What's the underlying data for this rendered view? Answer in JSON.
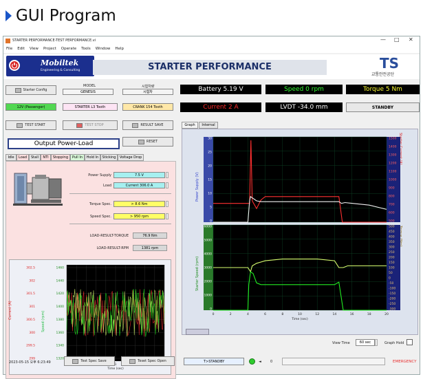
{
  "page_title": "GUI Program",
  "window": {
    "title": "STARTER PERFORMANCE-TEST PERFORMANCE.vi",
    "controls": [
      "—",
      "□",
      "✕"
    ],
    "menu": [
      "File",
      "Edit",
      "View",
      "Project",
      "Operate",
      "Tools",
      "Window",
      "Help"
    ]
  },
  "header": {
    "logo_name": "Mobiltek",
    "logo_sub": "Engineering & Consulting",
    "app_title": "STARTER PERFORMANCE",
    "ts_logo": "TS",
    "ts_sub": "교통안전공단"
  },
  "config": {
    "button": "Starter Config",
    "model_label": "MODEL",
    "model_value": "GENESIS",
    "sample_label": "시험차량",
    "sample_value": "시험차",
    "voltage_type": "12V (Passenger)",
    "starter_tooth": "STARTER L3 Tooth",
    "crank_tooth": "CRANK 154 Tooth"
  },
  "status": {
    "battery": "Battery 5.19 V",
    "speed": "Speed 0 rpm",
    "torque": "Torque 5 Nm",
    "current": "Current 2 A",
    "lvdt": "LVDT -34.0 mm",
    "state": "STANDBY"
  },
  "colors": {
    "battery": "#ffffff",
    "speed": "#33ff33",
    "torque": "#ffff33",
    "current": "#ff2a2a",
    "lvdt": "#ffffff"
  },
  "controls": {
    "test_start": "TEST START",
    "test_stop": "TEST STOP",
    "result_save": "RESULT SAVE",
    "reset": "RESET",
    "mode_display": "Output Power-Load"
  },
  "left_tabs": [
    "Idle",
    "Load",
    "Stall",
    "NTI",
    "Stopping",
    "Pull In",
    "Hold In",
    "Sticking",
    "Voltage Drop"
  ],
  "load": {
    "power_supply_label": "Power Supply",
    "power_supply_value": "7.5 V",
    "load_label": "Load",
    "load_value": "Current 306.0 A",
    "torque_spec_label": "Torque Spec.",
    "torque_spec_value": "> 8.6 Nm",
    "speed_spec_label": "Speed Spec.",
    "speed_spec_value": "> 950 rpm",
    "result_torque_label": "LOAD-RESULT-TORQUE",
    "result_torque_value": "76.9 Nm",
    "result_rpm_label": "LOAD-RESULT-RPM",
    "result_rpm_value": "1381 rpm"
  },
  "small_chart": {
    "left_axis_label": "Current (A)",
    "right_axis_label": "Speed (rpm)",
    "left_ticks": [
      "302.5",
      "302",
      "301.5",
      "301",
      "300.5",
      "300",
      "299.5",
      "299"
    ],
    "right_ticks": [
      "1460",
      "1440",
      "1420",
      "1400",
      "1380",
      "1360",
      "1340",
      "1320"
    ],
    "x_ticks": [
      "0",
      "0.2",
      "0.4",
      "0.6",
      "0.8",
      "1",
      "1.2",
      "1.4",
      "1.6",
      "1.8",
      "2"
    ],
    "xlabel": "Time (sec)"
  },
  "graph_tabs": [
    "Graph",
    "Internal"
  ],
  "chart_data": {
    "type": "line",
    "top": {
      "left_label": "Power Supply (V)",
      "right_label": "Starter Current (A)",
      "left_ticks": [
        "30",
        "25",
        "20",
        "15",
        "10",
        "5",
        "0"
      ],
      "right_ticks": [
        "1500",
        "1400",
        "1300",
        "1200",
        "1100",
        "1000",
        "900",
        "800",
        "700",
        "600",
        "500"
      ]
    },
    "bottom": {
      "left_label": "Starter Speed (rpm)",
      "right_label": "Torque (Nm)",
      "left_ticks": [
        "6000",
        "5000",
        "4000",
        "3000",
        "2000",
        "1000",
        "0"
      ],
      "right_ticks": [
        "500",
        "450",
        "400",
        "350",
        "300",
        "250",
        "200",
        "150",
        "100",
        "50",
        "0",
        "-50",
        "-100",
        "-150",
        "-200",
        "-250",
        "-300"
      ]
    },
    "x_ticks": [
      "0",
      "2",
      "4",
      "6",
      "8",
      "10",
      "12",
      "14",
      "16",
      "18",
      "20"
    ],
    "xlabel": "Time (sec)",
    "series": [
      {
        "color": "#ff3030",
        "x": [
          0,
          4.2,
          4.35,
          4.5,
          5,
          5.5,
          6,
          8,
          10,
          12,
          14.5,
          14.9,
          15.2,
          20
        ],
        "y": [
          0.22,
          0.22,
          0.96,
          0.25,
          0.16,
          0.26,
          0.3,
          0.3,
          0.3,
          0.3,
          0.3,
          0.0,
          0.0,
          0.0
        ]
      },
      {
        "color": "#f2f2f2",
        "x": [
          0,
          4.0,
          4.2,
          4.3,
          5,
          5.5,
          6,
          8,
          10,
          12,
          14.5,
          14.8,
          15.2,
          18,
          20
        ],
        "y": [
          0.0,
          0.0,
          0.25,
          0.3,
          0.25,
          0.24,
          0.24,
          0.24,
          0.24,
          0.24,
          0.24,
          0.22,
          0.23,
          0.2,
          0.15
        ]
      },
      {
        "color": "#d8ff70",
        "x": [
          0,
          4.0,
          4.3,
          4.5,
          5,
          6,
          8,
          10,
          12,
          14,
          14.5,
          15,
          15.5,
          20
        ],
        "y": [
          0.5,
          0.5,
          0.45,
          0.52,
          0.55,
          0.58,
          0.6,
          0.6,
          0.6,
          0.58,
          0.5,
          0.5,
          0.52,
          0.52
        ]
      },
      {
        "color": "#22ee22",
        "x": [
          0,
          4.0,
          4.1,
          4.3,
          4.6,
          5,
          5.5,
          6,
          8,
          10,
          12,
          14,
          14.5,
          15,
          15.2,
          20
        ],
        "y": [
          0.0,
          0.0,
          0.3,
          0.45,
          0.43,
          0.32,
          0.3,
          0.3,
          0.3,
          0.3,
          0.3,
          0.3,
          0.33,
          0.0,
          0.0,
          0.0
        ]
      }
    ]
  },
  "graph_bottom": {
    "view_time_label": "View Time",
    "view_time_value": "60 sec",
    "graph_hold_label": "Graph Hold"
  },
  "footer": {
    "datetime": "2023-05-15 오후 6:23:49",
    "test_spec_save": "Test Spec Save",
    "test_spec_open": "Teset Spec Open",
    "state_text": "T>STANDBY",
    "counter": "0",
    "emergency": "EMERGENCY"
  }
}
